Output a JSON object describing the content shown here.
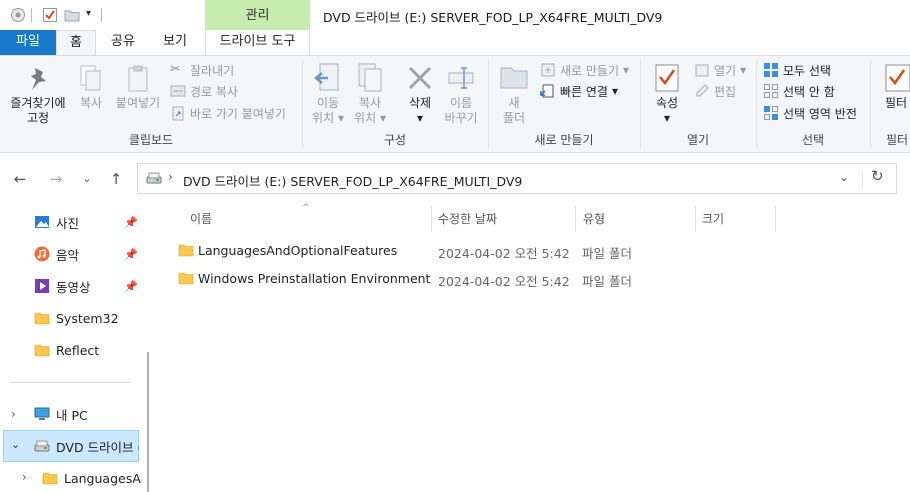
{
  "titlebar": {
    "context_tab_header": "관리",
    "window_title": "DVD 드라이브 (E:) SERVER_FOD_LP_X64FRE_MULTI_DV9"
  },
  "tabs": [
    "파일",
    "홈",
    "공유",
    "보기",
    "드라이브 도구"
  ],
  "ribbon": {
    "clipboard": {
      "label": "클립보드",
      "pin_line1": "즐겨찾기에",
      "pin_line2": "고정",
      "copy": "복사",
      "paste": "붙여넣기",
      "cut": "잘라내기",
      "copy_path": "경로 복사",
      "paste_shortcut": "바로 가기 붙여넣기"
    },
    "organize": {
      "label": "구성",
      "move_line1": "이동",
      "move_line2": "위치",
      "copy_line1": "복사",
      "copy_line2": "위치",
      "delete": "삭제",
      "rename_line1": "이름",
      "rename_line2": "바꾸기"
    },
    "new": {
      "label": "새로 만들기",
      "folder_line1": "새",
      "folder_line2": "폴더",
      "new_item": "새로 만들기",
      "easy_access": "빠른 연결"
    },
    "open": {
      "label": "열기",
      "properties": "속성",
      "open": "열기",
      "edit": "편집"
    },
    "select": {
      "label": "선택",
      "select_all": "모두 선택",
      "select_none": "선택 안 함",
      "invert": "선택 영역 반전"
    },
    "filter": {
      "label": "필터",
      "button": "필터"
    }
  },
  "address": {
    "path": "DVD 드라이브 (E:) SERVER_FOD_LP_X64FRE_MULTI_DV9"
  },
  "nav": {
    "quick": [
      {
        "label": "사진",
        "pinned": true
      },
      {
        "label": "음악",
        "pinned": true
      },
      {
        "label": "동영상",
        "pinned": true
      },
      {
        "label": "System32",
        "pinned": false
      },
      {
        "label": "Reflect",
        "pinned": false
      }
    ],
    "this_pc": "내 PC",
    "dvd": "DVD 드라이브 (",
    "languages": "LanguagesAnc"
  },
  "columns": {
    "name": "이름",
    "modified": "수정한 날짜",
    "type": "유형",
    "size": "크기"
  },
  "files": [
    {
      "name": "LanguagesAndOptionalFeatures",
      "modified": "2024-04-02 오전 5:42",
      "type": "파일 폴더"
    },
    {
      "name": "Windows Preinstallation Environment",
      "modified": "2024-04-02 오전 5:42",
      "type": "파일 폴더"
    }
  ],
  "colors": {
    "file_tab": "#1979ca",
    "context_tab": "#c6ecaf",
    "selection": "#cce8ff",
    "folder": "#f8c74b"
  }
}
